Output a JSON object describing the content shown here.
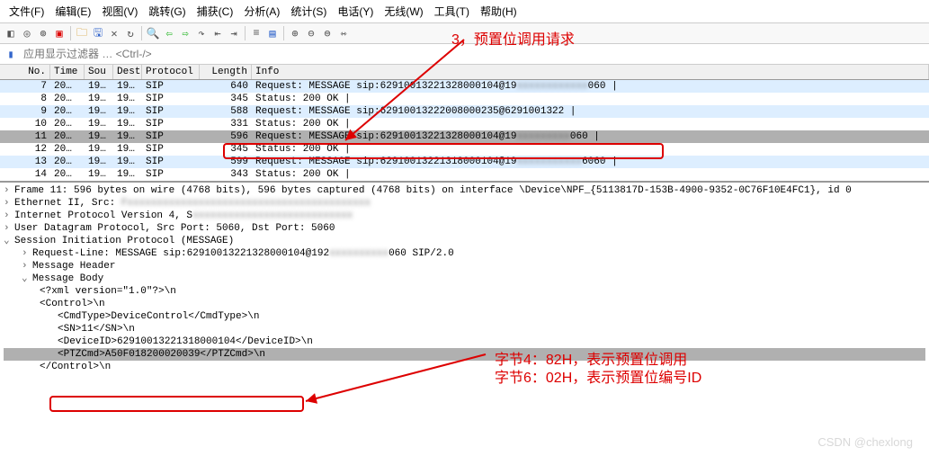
{
  "menu": {
    "items": [
      "文件(F)",
      "编辑(E)",
      "视图(V)",
      "跳转(G)",
      "捕获(C)",
      "分析(A)",
      "统计(S)",
      "电话(Y)",
      "无线(W)",
      "工具(T)",
      "帮助(H)"
    ]
  },
  "filter": {
    "placeholder": "应用显示过滤器 … <Ctrl-/>"
  },
  "packet_header": {
    "no": "No.",
    "time": "Time",
    "src": "Sou",
    "dst": "Dest",
    "proto": "Protocol",
    "len": "Length",
    "info": "Info"
  },
  "packets": [
    {
      "no": "7",
      "time": "20…",
      "src": "19…",
      "dst": "19…",
      "proto": "SIP",
      "len": "640",
      "info": "Request: MESSAGE sip:62910013221328000104@19",
      "info_blur": "xxxxxxxxxxxx",
      "info_tail": "060 |"
    },
    {
      "no": "8",
      "time": "20…",
      "src": "19…",
      "dst": "19…",
      "proto": "SIP",
      "len": "345",
      "info": "Status: 200 OK |",
      "info_blur": "",
      "info_tail": ""
    },
    {
      "no": "9",
      "time": "20…",
      "src": "19…",
      "dst": "19…",
      "proto": "SIP",
      "len": "588",
      "info": "Request: MESSAGE sip:62910013222008000235@6291001322 |",
      "info_blur": "",
      "info_tail": ""
    },
    {
      "no": "10",
      "time": "20…",
      "src": "19…",
      "dst": "19…",
      "proto": "SIP",
      "len": "331",
      "info": "Status: 200 OK |",
      "info_blur": "",
      "info_tail": ""
    },
    {
      "no": "11",
      "time": "20…",
      "src": "19…",
      "dst": "19…",
      "proto": "SIP",
      "len": "596",
      "info": "Request: MESSAGE sip:62910013221328000104@19",
      "info_blur": "xxxxxxxxx",
      "info_tail": "060 |"
    },
    {
      "no": "12",
      "time": "20…",
      "src": "19…",
      "dst": "19…",
      "proto": "SIP",
      "len": "345",
      "info": "Status: 200 OK |",
      "info_blur": "",
      "info_tail": ""
    },
    {
      "no": "13",
      "time": "20…",
      "src": "19…",
      "dst": "19…",
      "proto": "SIP",
      "len": "599",
      "info": "Request: MESSAGE sip:62910013221318000104@19",
      "info_blur": "xxxxxxxxxxx",
      "info_tail": "6060 |"
    },
    {
      "no": "14",
      "time": "20…",
      "src": "19…",
      "dst": "19…",
      "proto": "SIP",
      "len": "343",
      "info": "Status: 200 OK |",
      "info_blur": "",
      "info_tail": ""
    }
  ],
  "details": {
    "frame": "Frame 11: 596 bytes on wire (4768 bits), 596 bytes captured (4768 bits) on interface \\Device\\NPF_{5113817D-153B-4900-9352-0C76F10E4FC1}, id 0",
    "eth": "Ethernet II, Src: ",
    "ipv4": "Internet Protocol Version 4, S",
    "udp": "User Datagram Protocol, Src Port: 5060, Dst Port: 5060",
    "sip": "Session Initiation Protocol (MESSAGE)",
    "reqline_pre": "Request-Line: MESSAGE sip:62910013221328000104@192",
    "reqline_post": "060 SIP/2.0",
    "msgheader": "Message Header",
    "msgbody": "Message Body",
    "xml": "<?xml version=\"1.0\"?>\\n",
    "ctrl_open": "<Control>\\n",
    "cmdtype": "<CmdType>DeviceControl</CmdType>\\n",
    "sn": "<SN>11</SN>\\n",
    "deviceid": "<DeviceID>62910013221318000104</DeviceID>\\n",
    "ptzcmd": "<PTZCmd>A50F018200020039</PTZCmd>\\n",
    "ctrl_close": "</Control>\\n"
  },
  "annotations": {
    "top": "3，预置位调用请求",
    "right1": "字节4：82H，表示预置位调用",
    "right2": "字节6：02H，表示预置位编号ID"
  },
  "watermark": "CSDN @chexlong"
}
